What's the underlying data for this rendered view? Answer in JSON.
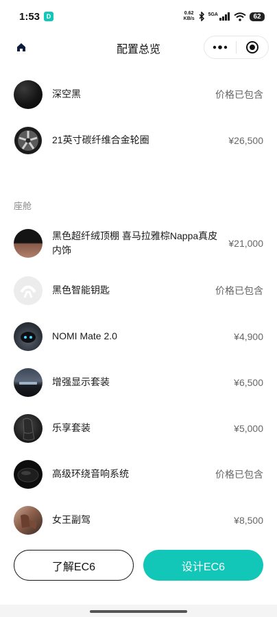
{
  "status_bar": {
    "time": "1:53",
    "app_badge": "D",
    "net_speed_value": "0.62",
    "net_speed_unit": "KB/s",
    "network_type": "5GA",
    "battery": "62"
  },
  "nav": {
    "title": "配置总览"
  },
  "exterior_items": [
    {
      "name": "深空黑",
      "price": "价格已包含"
    },
    {
      "name": "21英寸碳纤维合金轮圈",
      "price": "¥26,500"
    }
  ],
  "cabin": {
    "section_label": "座舱",
    "items": [
      {
        "name": "黑色超纤绒顶棚 喜马拉雅棕Nappa真皮内饰",
        "price": "¥21,000"
      },
      {
        "name": "黑色智能钥匙",
        "price": "价格已包含"
      },
      {
        "name": "NOMI Mate 2.0",
        "price": "¥4,900"
      },
      {
        "name": "增强显示套装",
        "price": "¥6,500"
      },
      {
        "name": "乐享套装",
        "price": "¥5,000"
      },
      {
        "name": "高级环绕音响系统",
        "price": "价格已包含"
      },
      {
        "name": "女王副驾",
        "price": "¥8,500"
      }
    ]
  },
  "buttons": {
    "learn": "了解EC6",
    "design": "设计EC6"
  },
  "colors": {
    "accent": "#12c7b8",
    "text_primary": "#1a1a1a",
    "text_secondary": "#666666"
  }
}
